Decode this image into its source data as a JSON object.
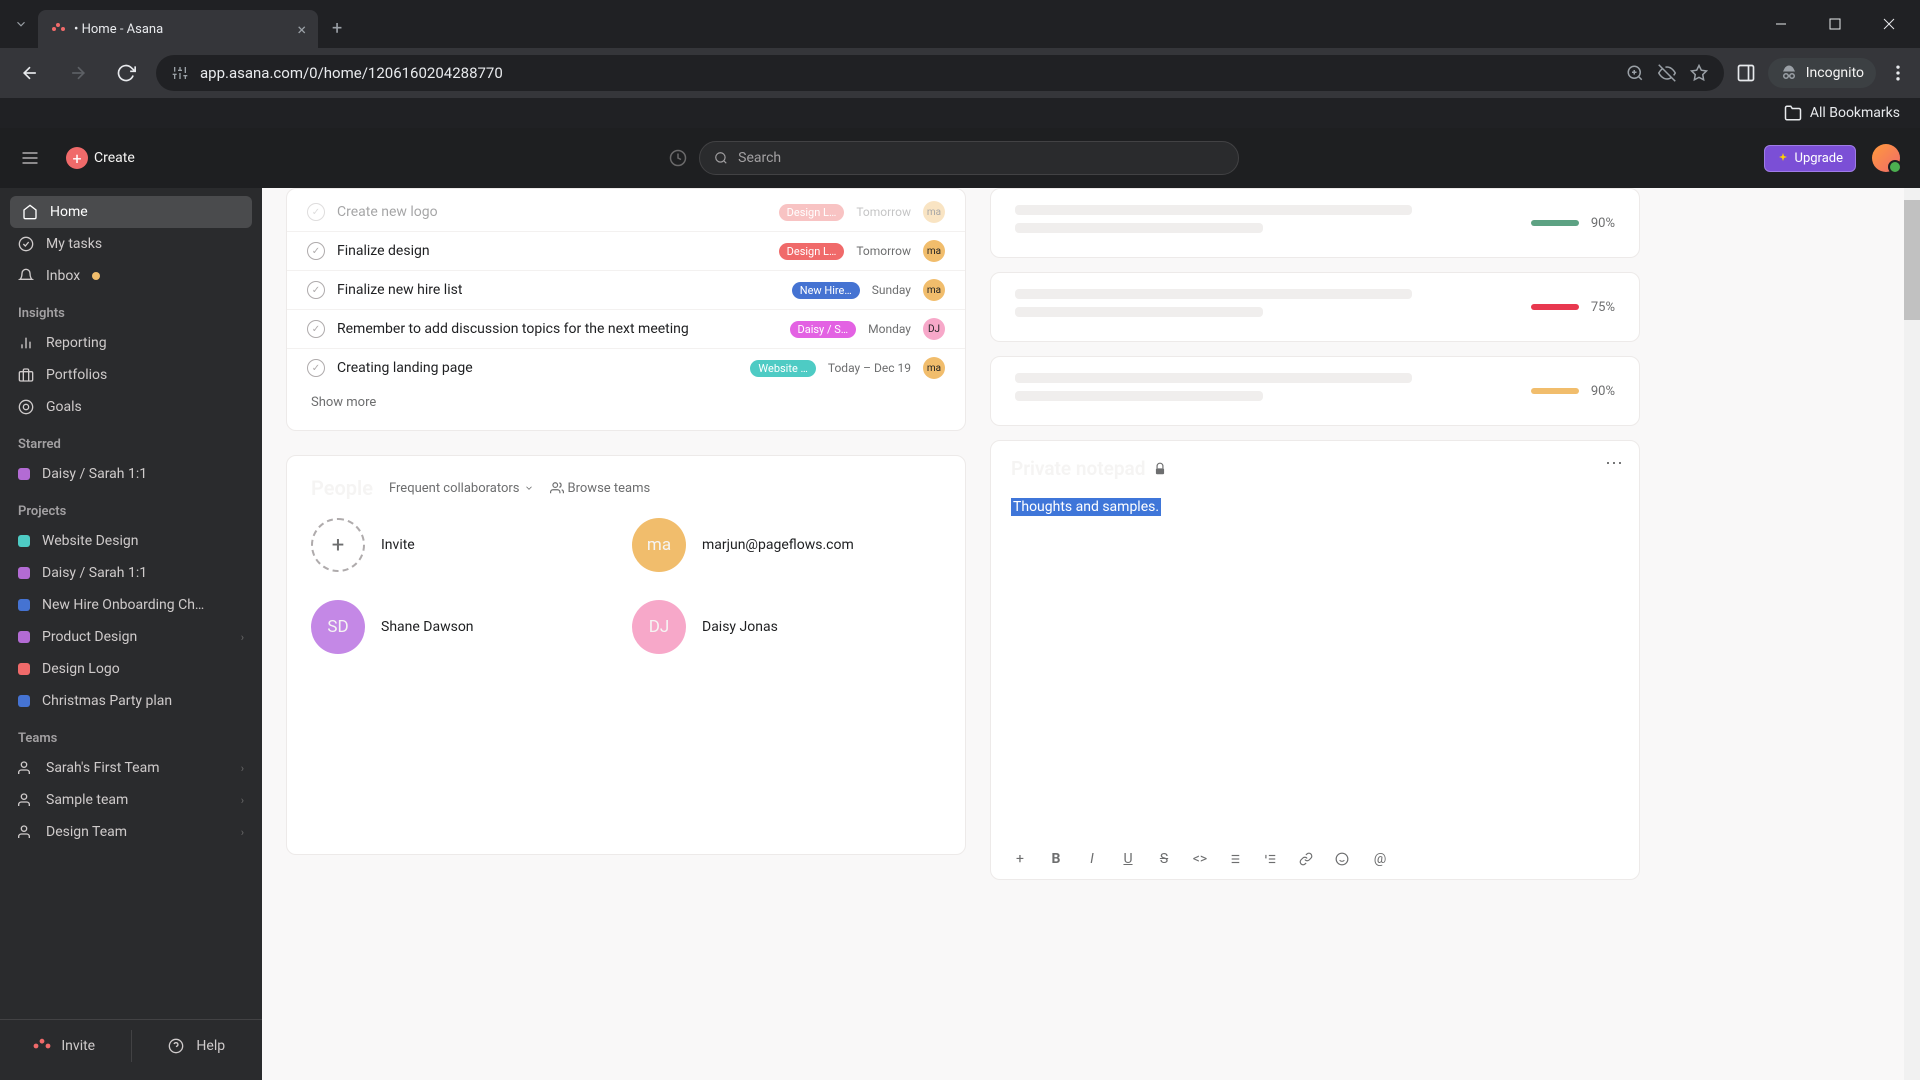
{
  "browser": {
    "tab_title": "• Home - Asana",
    "url": "app.asana.com/0/home/1206160204288770",
    "incognito_label": "Incognito",
    "bookmarks_label": "All Bookmarks"
  },
  "header": {
    "create_label": "Create",
    "search_placeholder": "Search",
    "upgrade_label": "Upgrade"
  },
  "sidebar": {
    "nav": [
      {
        "icon": "home",
        "label": "Home",
        "active": true
      },
      {
        "icon": "check",
        "label": "My tasks"
      },
      {
        "icon": "bell",
        "label": "Inbox",
        "badge": true
      }
    ],
    "insights_label": "Insights",
    "insights": [
      {
        "icon": "reporting",
        "label": "Reporting"
      },
      {
        "icon": "portfolio",
        "label": "Portfolios"
      },
      {
        "icon": "goal",
        "label": "Goals"
      }
    ],
    "starred_label": "Starred",
    "starred": [
      {
        "color": "#b36bd4",
        "label": "Daisy / Sarah 1:1"
      }
    ],
    "projects_label": "Projects",
    "projects": [
      {
        "color": "#4ecbc4",
        "label": "Website Design"
      },
      {
        "color": "#b36bd4",
        "label": "Daisy / Sarah 1:1"
      },
      {
        "color": "#4573d2",
        "label": "New Hire Onboarding Ch…"
      },
      {
        "color": "#b36bd4",
        "label": "Product Design",
        "expandable": true
      },
      {
        "color": "#f06a6a",
        "label": "Design Logo"
      },
      {
        "color": "#4573d2",
        "label": "Christmas Party plan"
      }
    ],
    "teams_label": "Teams",
    "teams": [
      {
        "label": "Sarah's First Team",
        "expandable": true
      },
      {
        "label": "Sample team",
        "expandable": true
      },
      {
        "label": "Design Team",
        "expandable": true
      }
    ],
    "invite_label": "Invite",
    "help_label": "Help"
  },
  "tasks": [
    {
      "name": "Create new logo",
      "tag": "Design L…",
      "tag_color": "#f06a6a",
      "date": "Tomorrow",
      "avatar": "ma",
      "avatar_color": "#f1bd6c"
    },
    {
      "name": "Finalize design",
      "tag": "Design L…",
      "tag_color": "#f06a6a",
      "date": "Tomorrow",
      "avatar": "ma",
      "avatar_color": "#f1bd6c"
    },
    {
      "name": "Finalize new hire list",
      "tag": "New Hire…",
      "tag_color": "#4573d2",
      "date": "Sunday",
      "avatar": "ma",
      "avatar_color": "#f1bd6c"
    },
    {
      "name": "Remember to add discussion topics for the next meeting",
      "tag": "Daisy / S…",
      "tag_color": "#e362e3",
      "date": "Monday",
      "avatar": "DJ",
      "avatar_color": "#f7a8c9"
    },
    {
      "name": "Creating landing page",
      "tag": "Website …",
      "tag_color": "#4ecbc4",
      "date": "Today – Dec 19",
      "avatar": "ma",
      "avatar_color": "#f1bd6c"
    }
  ],
  "show_more_label": "Show more",
  "people": {
    "title": "People",
    "filter_label": "Frequent collaborators",
    "browse_label": "Browse teams",
    "items": [
      {
        "type": "invite",
        "label": "Invite"
      },
      {
        "avatar": "ma",
        "color": "#f1bd6c",
        "label": "marjun@pageflows.com"
      },
      {
        "avatar": "SD",
        "color": "#c488e6",
        "label": "Shane Dawson"
      },
      {
        "avatar": "DJ",
        "color": "#f7a8c9",
        "label": "Daisy Jonas"
      }
    ]
  },
  "progress": [
    {
      "color": "#5da283",
      "pct": "90%"
    },
    {
      "color": "#e8384f",
      "pct": "75%"
    },
    {
      "color": "#f1bd6c",
      "pct": "90%"
    }
  ],
  "notepad": {
    "title": "Private notepad",
    "content": "Thoughts and samples."
  }
}
